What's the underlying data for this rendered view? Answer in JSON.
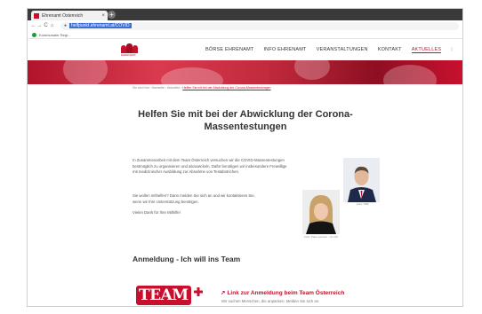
{
  "browser": {
    "tab_title": "Ehrenamt Österreich",
    "tab_close": "×",
    "new_tab": "+",
    "back": "←",
    "forward": "→",
    "reload": "C",
    "home": "⌂",
    "lock": "🔒",
    "url": "helfpunkt.ehrenamt.at/COVID",
    "bookmark": "Kommunaler Regi..."
  },
  "site": {
    "logo_text": "EHRENAMT",
    "menu": [
      "BÖRSE EHRENAMT",
      "INFO EHRENAMT",
      "VERANSTALTUNGEN",
      "KONTAKT",
      "AKTUELLES"
    ],
    "menu_active": "AKTUELLES",
    "menu_sep": "|",
    "search_icon": "Q",
    "search_label": "S",
    "breadcrumb_prefix": "Sie sind hier:",
    "breadcrumb_items": [
      "Startseite",
      "Aktuelles"
    ],
    "breadcrumb_current": "Helfen Sie mit bei der Abwicklung der Corona-Massentestungen"
  },
  "article": {
    "title": "Helfen Sie mit bei der Abwicklung der Corona-Massentestungen",
    "para1_line1": "In Zusammenarbeit mit dem Team Österreich versuchen wir die COVID-Massentestungen",
    "para1_line2": "bestmöglich zu organisieren und abzuwickeln. Dafür benötigen wir insbesondere Freiwillige",
    "para1_line3": "mit medizinischer Ausbildung zur Abnahme von Testabstrichen.",
    "para2_line1": "Sie wollen mithelfen? Dann melden Sie sich an und wir kontaktieren Sie,",
    "para2_line2": "wenn wir Ihre Unterstützung benötigen.",
    "para3": "Vielen Dank für Ihre Mithilfe!",
    "photo1_caption": "Foto: ORF",
    "photo2_caption": "Foto: Peter Lehnert - LK OÖ",
    "section_title": "Anmeldung - Ich will ins Team",
    "team_logo": "TEAM",
    "link_text": "Link zur Anmeldung beim Team Österreich",
    "link_desc": "Wir suchen Menschen, die anpacken. Melden Sie sich an."
  },
  "colors": {
    "brand_red": "#c8102e",
    "chrome_dark": "#3a3a3a"
  }
}
